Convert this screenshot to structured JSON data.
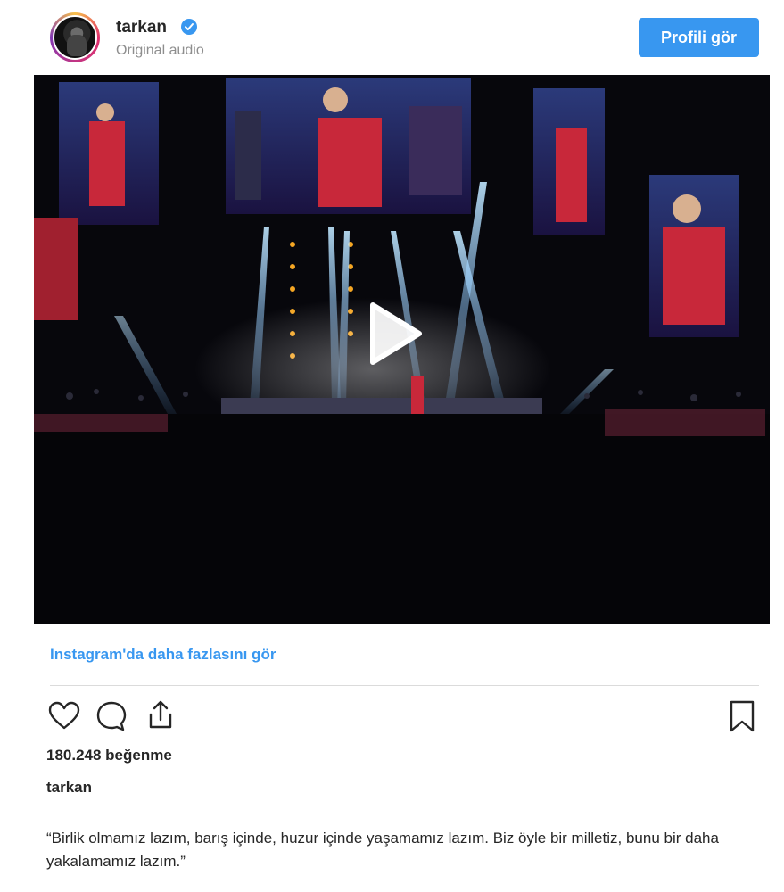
{
  "header": {
    "username": "tarkan",
    "subtitle": "Original audio",
    "profile_button": "Profili gör",
    "verified_icon": "verified-badge-icon"
  },
  "video": {
    "play_icon": "play-icon"
  },
  "more_link": "Instagram'da daha fazlasını gör",
  "actions": {
    "like_icon": "heart-icon",
    "comment_icon": "comment-icon",
    "share_icon": "share-icon",
    "save_icon": "bookmark-icon"
  },
  "likes": "180.248 beğenme",
  "caption": {
    "username": "tarkan",
    "text": "“Birlik olmamız lazım, barış içinde, huzur içinde yaşamamız lazım. Biz öyle bir milletiz, bunu bir daha yakalamamız lazım.”"
  },
  "colors": {
    "accent": "#3897f0",
    "text": "#262626",
    "muted": "#8e8e8e"
  }
}
